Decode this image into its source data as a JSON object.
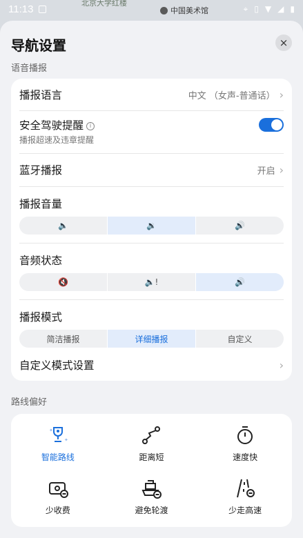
{
  "status": {
    "time": "11:13"
  },
  "map": {
    "label_partial": "北京大学红楼",
    "label": "中国美术馆"
  },
  "header": {
    "title": "导航设置",
    "close_label": "×"
  },
  "voice": {
    "section_label": "语音播报",
    "language": {
      "label": "播报语言",
      "value": "中文 （女声-普通话）"
    },
    "safety": {
      "label": "安全驾驶提醒",
      "sub": "播报超速及违章提醒",
      "enabled": true
    },
    "bluetooth": {
      "label": "蓝牙播报",
      "value": "开启"
    },
    "volume": {
      "label": "播报音量",
      "options": [
        "🔈",
        "🔉",
        "🔊"
      ],
      "selected": 1
    },
    "audio_state": {
      "label": "音频状态",
      "options": [
        "🔇",
        "🔈!",
        "🔊"
      ],
      "selected": 2
    },
    "mode": {
      "label": "播报模式",
      "options": [
        "简洁播报",
        "详细播报",
        "自定义"
      ],
      "selected": 1
    },
    "custom": {
      "label": "自定义模式设置"
    }
  },
  "route": {
    "section_label": "路线偏好",
    "items": [
      {
        "label": "智能路线",
        "icon": "smart-route-icon",
        "active": true
      },
      {
        "label": "距离短",
        "icon": "short-distance-icon",
        "active": false
      },
      {
        "label": "速度快",
        "icon": "stopwatch-icon",
        "active": false
      },
      {
        "label": "少收费",
        "icon": "toll-icon",
        "active": false
      },
      {
        "label": "避免轮渡",
        "icon": "ferry-icon",
        "active": false
      },
      {
        "label": "少走高速",
        "icon": "highway-icon",
        "active": false
      }
    ]
  },
  "colors": {
    "accent": "#1a6fdc",
    "card": "#ffffff",
    "sheet": "#f1f2f5"
  }
}
